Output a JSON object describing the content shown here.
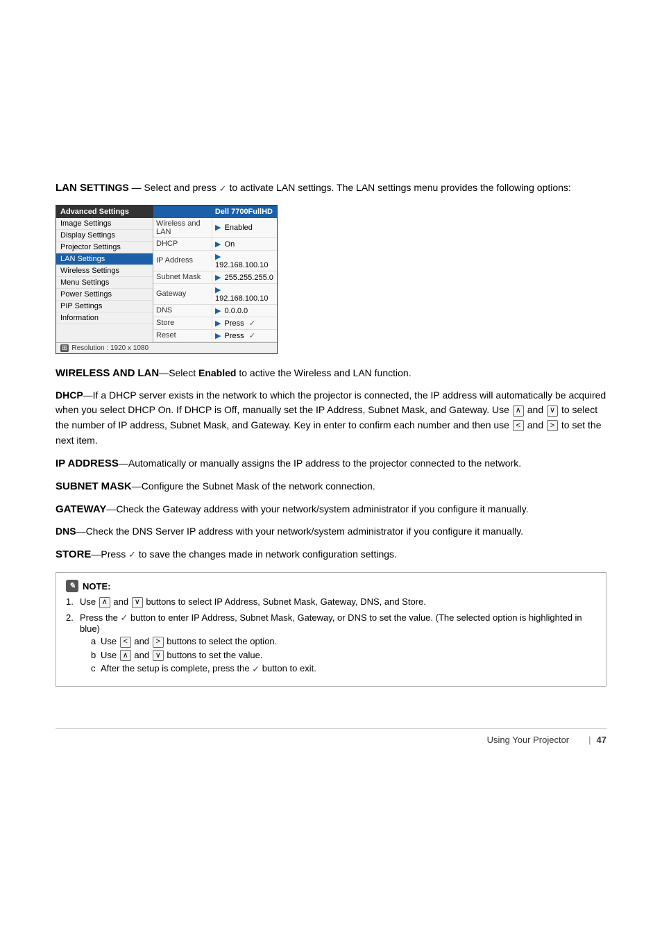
{
  "page": {
    "number": "47"
  },
  "footer": {
    "label": "Using Your Projector",
    "separator": "|",
    "page": "47"
  },
  "top_section": {
    "heading": "LAN S",
    "heading_caps": "ETTINGS",
    "heading_dash": "—",
    "intro_text": "Select and press",
    "intro_check": "✓",
    "intro_rest": "to activate LAN settings. The LAN settings menu provides the following options:"
  },
  "menu": {
    "header_left": "Advanced Settings",
    "header_right": "Dell 7700FullHD",
    "left_items": [
      {
        "label": "Image Settings",
        "active": false
      },
      {
        "label": "Display Settings",
        "active": false
      },
      {
        "label": "Projector Settings",
        "active": false
      },
      {
        "label": "LAN Settings",
        "active": true
      },
      {
        "label": "Wireless Settings",
        "active": false
      },
      {
        "label": "Menu Settings",
        "active": false
      },
      {
        "label": "Power Settings",
        "active": false
      },
      {
        "label": "PIP Settings",
        "active": false
      },
      {
        "label": "Information",
        "active": false
      }
    ],
    "right_rows": [
      {
        "label": "Wireless and LAN",
        "value": "Enabled",
        "has_arrow": true
      },
      {
        "label": "DHCP",
        "value": "On",
        "has_arrow": true
      },
      {
        "label": "IP Address",
        "value": "192.168.100.10",
        "has_arrow": true
      },
      {
        "label": "Subnet Mask",
        "value": "255.255.255.0",
        "has_arrow": true
      },
      {
        "label": "Gateway",
        "value": "192.168.100.10",
        "has_arrow": true
      },
      {
        "label": "DNS",
        "value": "0.0.0.0",
        "has_arrow": true
      },
      {
        "label": "Store",
        "value": "Press",
        "has_arrow": true,
        "has_check": true
      },
      {
        "label": "Reset",
        "value": "Press",
        "has_arrow": true,
        "has_check": true
      }
    ],
    "footer_res": "Resolution : 1920 x 1080"
  },
  "wireless_lan": {
    "term": "W",
    "term_caps": "IRELESS AND",
    "term_end": " LAN",
    "dash": "—",
    "text": "Select Enabled to active the Wireless and LAN function."
  },
  "dhcp": {
    "term": "DHCP",
    "dash": "—",
    "text": "If a DHCP server exists in the network to which the projector is connected, the IP address will automatically be acquired when you select DHCP On. If DHCP is Off, manually set the IP Address, Subnet Mask, and Gateway. Use",
    "up_arrow": "∧",
    "and": "and",
    "down_arrow": "∨",
    "text2": "to select the number of IP address, Subnet Mask, and Gateway. Key in enter to confirm each number and then use",
    "left_arrow": "<",
    "and2": "and",
    "right_arrow": ">",
    "text3": "to set the next item."
  },
  "ip_address": {
    "term": "IP A",
    "term_caps": "DDRESS",
    "dash": "—",
    "text": "Automatically or manually assigns the IP address to the projector connected to the network."
  },
  "subnet_mask": {
    "term": "S",
    "term_caps": "UBNET",
    "term_end": " M",
    "term_caps2": "ASK",
    "dash": "—",
    "text": "Configure the Subnet Mask of the network connection."
  },
  "gateway": {
    "term": "G",
    "term_caps": "ATEWAY",
    "dash": "—",
    "text": "Check the Gateway address with your network/system administrator if you configure it manually."
  },
  "dns": {
    "term": "DNS",
    "dash": "—",
    "text": "Check the DNS Server IP address with your network/system administrator if you configure it manually."
  },
  "store": {
    "term": "S",
    "term_caps": "TORE",
    "dash": "—",
    "text": "Press",
    "check": "✓",
    "text2": "to save the changes made in network configuration settings."
  },
  "note": {
    "heading": "NOTE:",
    "items": [
      {
        "num": "1.",
        "text": "Use",
        "up": "∧",
        "and": "and",
        "down": "∨",
        "text2": "buttons to select IP Address, Subnet Mask, Gateway, DNS, and Store."
      },
      {
        "num": "2.",
        "text": "Press the",
        "check": "✓",
        "text2": "button to enter IP Address, Subnet Mask, Gateway, or DNS to set the value. (The selected option is highlighted in blue)",
        "sub_items": [
          {
            "label": "a",
            "text": "Use",
            "left": "<",
            "and": "and",
            "right": ">",
            "text2": "buttons to select the option."
          },
          {
            "label": "b",
            "text": "Use",
            "up": "∧",
            "and": "and",
            "down": "∨",
            "text2": "buttons to set the value."
          },
          {
            "label": "c",
            "text": "After the setup is complete, press the",
            "check": "✓",
            "text2": "button to exit."
          }
        ]
      }
    ]
  }
}
